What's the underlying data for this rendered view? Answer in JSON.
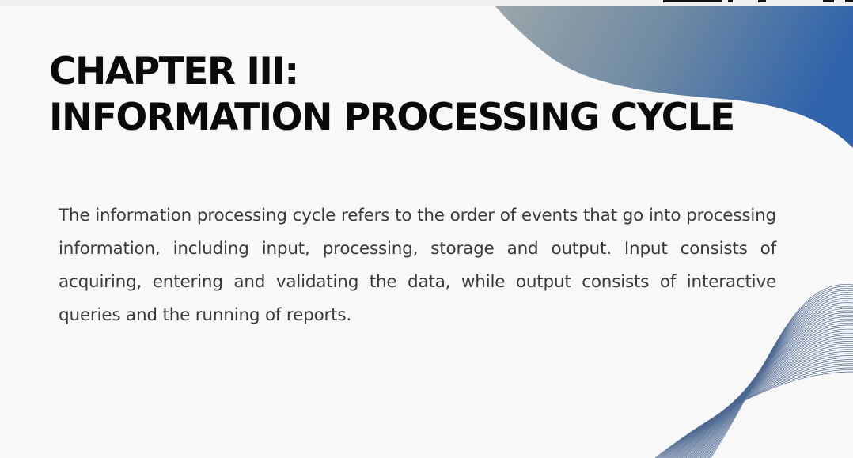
{
  "slide": {
    "title_line1": "CHAPTER III:",
    "title_line2": "INFORMATION PROCESSING CYCLE",
    "body": "The information processing cycle refers to the order of events that go into processing information, including input, processing, storage and output. Input consists of acquiring, entering and validating the data, while output consists of interactive queries and the running of reports."
  },
  "colors": {
    "title": "#0a0a0a",
    "body": "#3a3a3a",
    "background": "#f8f8f8",
    "wave_start": "#9aa5aa",
    "wave_end": "#3166aa",
    "lines": "#2f4f7f"
  }
}
